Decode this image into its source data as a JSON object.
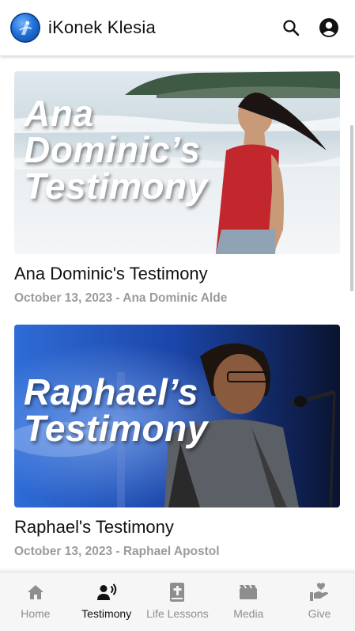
{
  "header": {
    "title": "iKonek Klesia",
    "logo_icon": "church-logo-icon",
    "search_icon": "search-icon",
    "account_icon": "account-circle-icon"
  },
  "posts": [
    {
      "title": "Ana Dominic's Testimony",
      "meta": "October 13, 2023 - Ana Dominic Alde",
      "thumb_lines": [
        "Ana",
        "Dominic’s",
        "Testimony"
      ]
    },
    {
      "title": "Raphael's Testimony",
      "meta": "October 13, 2023 - Raphael Apostol",
      "thumb_lines": [
        "Raphael’s",
        "Testimony"
      ]
    }
  ],
  "nav": {
    "items": [
      {
        "label": "Home",
        "icon": "home-icon"
      },
      {
        "label": "Testimony",
        "icon": "testimony-speaker-icon",
        "active": true
      },
      {
        "label": "Life Lessons",
        "icon": "bible-icon"
      },
      {
        "label": "Media",
        "icon": "film-icon"
      },
      {
        "label": "Give",
        "icon": "giving-hand-heart-icon"
      }
    ]
  },
  "colors": {
    "active": "#111111",
    "inactive": "#8e8e8e",
    "meta": "#9b9b9b"
  }
}
